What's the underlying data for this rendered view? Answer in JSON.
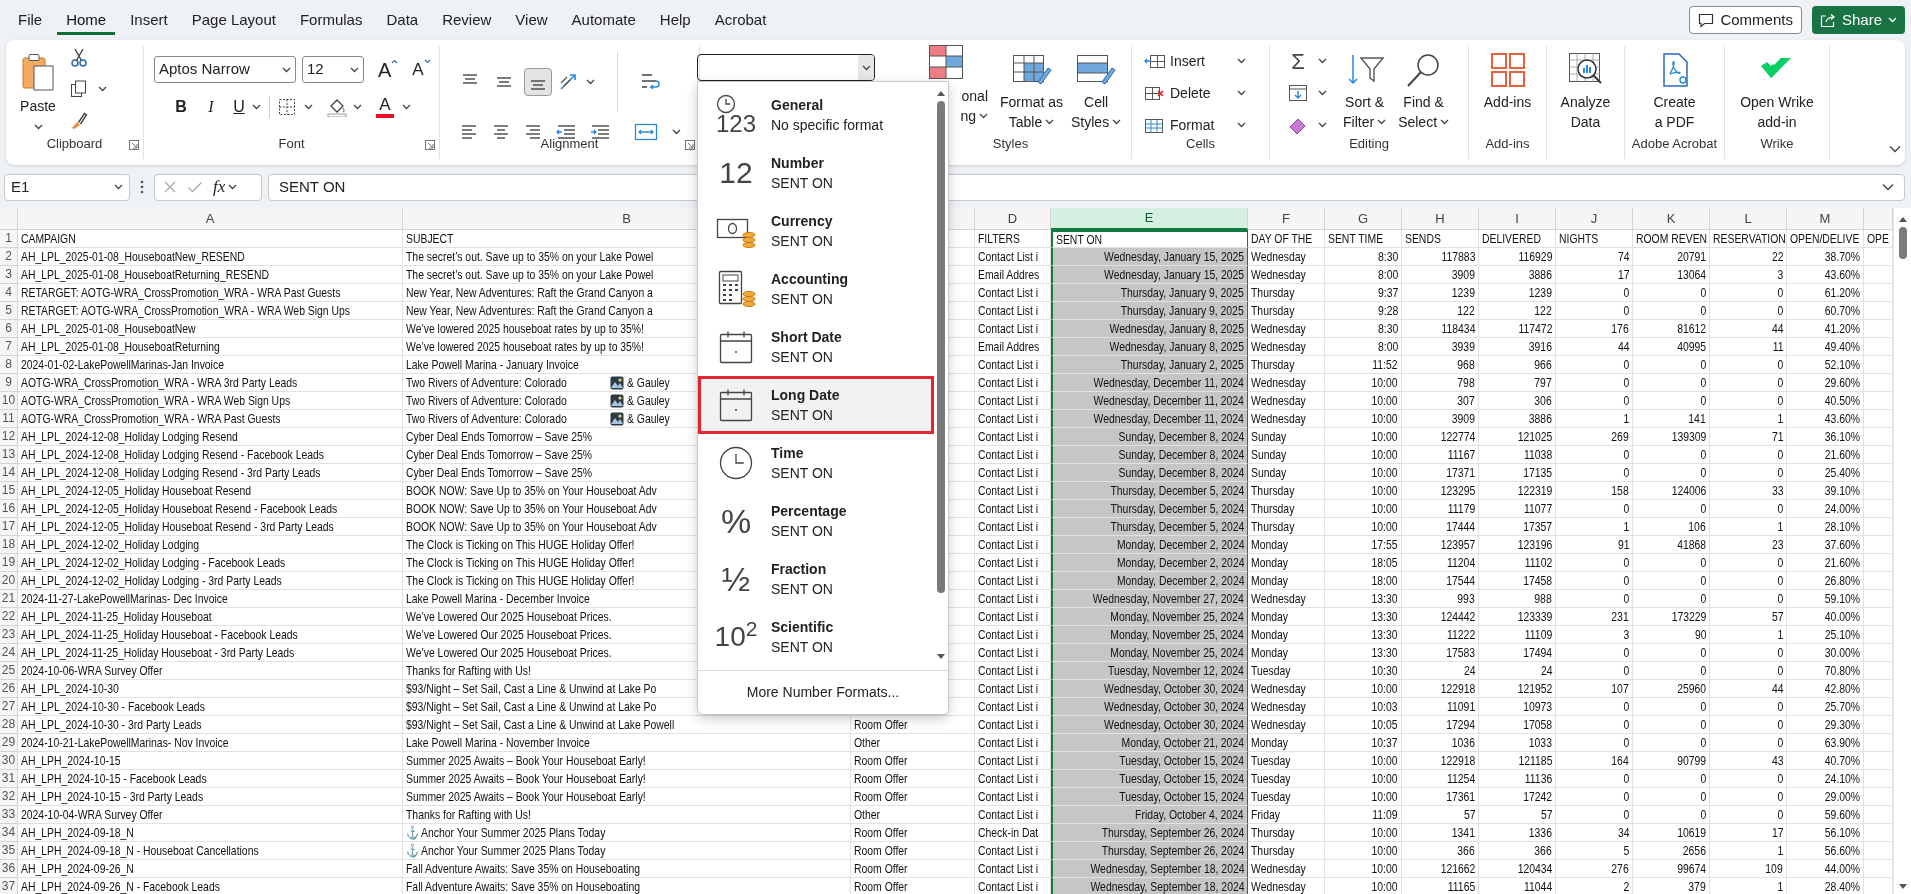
{
  "menu_tabs": [
    {
      "label": "File",
      "selected": false
    },
    {
      "label": "Home",
      "selected": true
    },
    {
      "label": "Insert",
      "selected": false
    },
    {
      "label": "Page Layout",
      "selected": false
    },
    {
      "label": "Formulas",
      "selected": false
    },
    {
      "label": "Data",
      "selected": false
    },
    {
      "label": "Review",
      "selected": false
    },
    {
      "label": "View",
      "selected": false
    },
    {
      "label": "Automate",
      "selected": false
    },
    {
      "label": "Help",
      "selected": false
    },
    {
      "label": "Acrobat",
      "selected": false
    }
  ],
  "comments_button": "Comments",
  "share_button": "Share",
  "ribbon": {
    "clipboard": {
      "paste": "Paste",
      "label": "Clipboard"
    },
    "font": {
      "family": "Aptos Narrow",
      "size": "12",
      "grow": "A",
      "shrink": "A",
      "bold": "B",
      "italic": "I",
      "underline": "U",
      "font_color": "A",
      "label": "Font"
    },
    "alignment": {
      "label": "Alignment",
      "vertical_align": [
        {
          "selected": false
        },
        {
          "selected": false
        },
        {
          "selected": true
        }
      ]
    },
    "styles": {
      "conditional": [
        "onal",
        "ng"
      ],
      "format_as_table": [
        "Format as",
        "Table"
      ],
      "cell_styles": [
        "Cell",
        "Styles"
      ],
      "label": "Styles"
    },
    "cells": {
      "buttons": [
        "Insert",
        "Delete",
        "Format"
      ],
      "label": "Cells"
    },
    "editing": {
      "autosum": "Σ",
      "sort_filter": [
        "Sort &",
        "Filter"
      ],
      "find_select": [
        "Find &",
        "Select"
      ],
      "label": "Editing"
    },
    "addins": {
      "button": "Add-ins",
      "label": "Add-ins"
    },
    "analyze": {
      "button": [
        "Analyze",
        "Data"
      ]
    },
    "acrobat": {
      "button": [
        "Create",
        "a PDF"
      ],
      "label": "Adobe Acrobat"
    },
    "wrike": {
      "button": [
        "Open Wrike",
        "add-in"
      ],
      "label": "Wrike"
    }
  },
  "formula_bar": {
    "name_box": "E1",
    "fx": "fx",
    "value": "SENT ON"
  },
  "format_menu": {
    "items": [
      {
        "kind": "general",
        "name": "General",
        "sample": "No specific format",
        "glyph": "123",
        "selected": false
      },
      {
        "kind": "number",
        "name": "Number",
        "sample": "SENT ON",
        "glyph": "12",
        "selected": false
      },
      {
        "kind": "currency",
        "name": "Currency",
        "sample": "SENT ON",
        "selected": false
      },
      {
        "kind": "accounting",
        "name": "Accounting",
        "sample": "SENT ON",
        "selected": false
      },
      {
        "kind": "short_date",
        "name": "Short Date",
        "sample": "SENT ON",
        "selected": false
      },
      {
        "kind": "long_date",
        "name": "Long Date",
        "sample": "SENT ON",
        "selected": true
      },
      {
        "kind": "time",
        "name": "Time",
        "sample": "SENT ON",
        "selected": false
      },
      {
        "kind": "percentage",
        "name": "Percentage",
        "sample": "SENT ON",
        "glyph": "%",
        "selected": false
      },
      {
        "kind": "fraction",
        "name": "Fraction",
        "sample": "SENT ON",
        "glyph": "½",
        "selected": false
      },
      {
        "kind": "scientific",
        "name": "Scientific",
        "sample": "SENT ON",
        "glyph": "10$^{2}$",
        "selected": false
      }
    ],
    "more": "More Number Formats..."
  },
  "grid": {
    "columns": [
      {
        "letter": "A",
        "selected": false
      },
      {
        "letter": "B",
        "selected": false
      },
      {
        "selected": false
      },
      {
        "letter": "D",
        "selected": false
      },
      {
        "letter": "E",
        "selected": true
      },
      {
        "letter": "F",
        "selected": false
      },
      {
        "letter": "G",
        "selected": false
      },
      {
        "letter": "H",
        "selected": false
      },
      {
        "letter": "I",
        "selected": false
      },
      {
        "letter": "J",
        "selected": false
      },
      {
        "letter": "K",
        "selected": false
      },
      {
        "letter": "L",
        "selected": false
      },
      {
        "letter": "M",
        "selected": false
      },
      {
        "selected": false
      }
    ],
    "rows": [
      {
        "row": "1",
        "active": true,
        "a": "CAMPAIGN",
        "b": "SUBJECT",
        "d": "FILTERS",
        "e": "SENT ON",
        "f": "DAY OF THE",
        "g": "SENT TIME",
        "h": "SENDS",
        "i": "DELIVERED",
        "j": "NIGHTS",
        "k": "ROOM REVEN",
        "l": "RESERVATION",
        "m": "OPEN/DELIVE",
        "n": "OPE"
      },
      {
        "row": "2",
        "active": false,
        "a": "AH_LPL_2025-01-08_HouseboatNew_RESEND",
        "b": "The secret’s out. Save up to 35% on your Lake Powel",
        "d": "Contact List i",
        "e": "Wednesday, January 15, 2025",
        "f": "Wednesday",
        "g": "8:30",
        "h": "117883",
        "i": "116929",
        "j": "74",
        "k": "20791",
        "l": "22",
        "m": "38.70%"
      },
      {
        "row": "3",
        "active": false,
        "a": "AH_LPL_2025-01-08_HouseboatReturning_RESEND",
        "b": "The secret’s out. Save up to 35% on your Lake Powel",
        "d": "Email Addres",
        "e": "Wednesday, January 15, 2025",
        "f": "Wednesday",
        "g": "8:00",
        "h": "3909",
        "i": "3886",
        "j": "17",
        "k": "13064",
        "l": "3",
        "m": "43.60%"
      },
      {
        "row": "4",
        "active": false,
        "a": "RETARGET: AOTG-WRA_CrossPromotion_WRA - WRA Past Guests",
        "b": "New Year, New Adventures: Raft the Grand Canyon a",
        "d": "Contact List i",
        "e": "Thursday, January 9, 2025",
        "f": "Thursday",
        "g": "9:37",
        "h": "1239",
        "i": "1239",
        "j": "0",
        "k": "0",
        "l": "0",
        "m": "61.20%"
      },
      {
        "row": "5",
        "active": false,
        "a": "RETARGET: AOTG-WRA_CrossPromotion_WRA - WRA Web Sign Ups",
        "b": "New Year, New Adventures: Raft the Grand Canyon a",
        "d": "Contact List i",
        "e": "Thursday, January 9, 2025",
        "f": "Thursday",
        "g": "9:28",
        "h": "122",
        "i": "122",
        "j": "0",
        "k": "0",
        "l": "0",
        "m": "60.70%"
      },
      {
        "row": "6",
        "active": false,
        "a": "AH_LPL_2025-01-08_HouseboatNew",
        "b": "We’ve lowered 2025 houseboat rates by up to 35%!",
        "d": "Contact List i",
        "e": "Wednesday, January 8, 2025",
        "f": "Wednesday",
        "g": "8:30",
        "h": "118434",
        "i": "117472",
        "j": "176",
        "k": "81612",
        "l": "44",
        "m": "41.20%"
      },
      {
        "row": "7",
        "active": false,
        "a": "AH_LPL_2025-01-08_HouseboatReturning",
        "b": "We’ve lowered 2025 houseboat rates by up to 35%!",
        "d": "Email Addres",
        "e": "Wednesday, January 8, 2025",
        "f": "Wednesday",
        "g": "8:00",
        "h": "3939",
        "i": "3916",
        "j": "44",
        "k": "40995",
        "l": "11",
        "m": "49.40%"
      },
      {
        "row": "8",
        "active": false,
        "a": "2024-01-02-LakePowellMarinas-Jan Invoice",
        "b": "Lake Powell Marina - January Invoice",
        "d": "Contact List i",
        "e": "Thursday, January 2, 2025",
        "f": "Thursday",
        "g": "11:52",
        "h": "968",
        "i": "966",
        "j": "0",
        "k": "0",
        "l": "0",
        "m": "52.10%"
      },
      {
        "row": "9",
        "active": false,
        "a": "AOTG-WRA_CrossPromotion_WRA - WRA 3rd Party Leads",
        "b": "Two Rivers of Adventure: Colorado",
        "b_after": "& Gauley",
        "d": "Contact List i",
        "e": "Wednesday, December 11, 2024",
        "f": "Wednesday",
        "g": "10:00",
        "h": "798",
        "i": "797",
        "j": "0",
        "k": "0",
        "l": "0",
        "m": "29.60%"
      },
      {
        "row": "10",
        "active": false,
        "a": "AOTG-WRA_CrossPromotion_WRA - WRA Web Sign Ups",
        "b": "Two Rivers of Adventure: Colorado",
        "b_after": "& Gauley",
        "d": "Contact List i",
        "e": "Wednesday, December 11, 2024",
        "f": "Wednesday",
        "g": "10:00",
        "h": "307",
        "i": "306",
        "j": "0",
        "k": "0",
        "l": "0",
        "m": "40.50%"
      },
      {
        "row": "11",
        "active": false,
        "a": "AOTG-WRA_CrossPromotion_WRA - WRA Past Guests",
        "b": "Two Rivers of Adventure: Colorado",
        "b_after": "& Gauley",
        "d": "Contact List i",
        "e": "Wednesday, December 11, 2024",
        "f": "Wednesday",
        "g": "10:00",
        "h": "3909",
        "i": "3886",
        "j": "1",
        "k": "141",
        "l": "1",
        "m": "43.60%"
      },
      {
        "row": "12",
        "active": false,
        "a": "AH_LPL_2024-12-08_Holiday Lodging Resend",
        "b": "Cyber Deal Ends Tomorrow – Save 25%",
        "d": "Contact List i",
        "e": "Sunday, December 8, 2024",
        "f": "Sunday",
        "g": "10:00",
        "h": "122774",
        "i": "121025",
        "j": "269",
        "k": "139309",
        "l": "71",
        "m": "36.10%"
      },
      {
        "row": "13",
        "active": false,
        "a": "AH_LPL_2024-12-08_Holiday Lodging Resend - Facebook Leads",
        "b": "Cyber Deal Ends Tomorrow – Save 25%",
        "d": "Contact List i",
        "e": "Sunday, December 8, 2024",
        "f": "Sunday",
        "g": "10:00",
        "h": "11167",
        "i": "11038",
        "j": "0",
        "k": "0",
        "l": "0",
        "m": "21.60%"
      },
      {
        "row": "14",
        "active": false,
        "a": "AH_LPL_2024-12-08_Holiday Lodging Resend - 3rd Party Leads",
        "b": "Cyber Deal Ends Tomorrow – Save 25%",
        "d": "Contact List i",
        "e": "Sunday, December 8, 2024",
        "f": "Sunday",
        "g": "10:00",
        "h": "17371",
        "i": "17135",
        "j": "0",
        "k": "0",
        "l": "0",
        "m": "25.40%"
      },
      {
        "row": "15",
        "active": false,
        "a": "AH_LPL_2024-12-05_Holiday Houseboat Resend",
        "b": "BOOK NOW: Save Up to 35% on Your Houseboat Adv",
        "d": "Contact List i",
        "e": "Thursday, December 5, 2024",
        "f": "Thursday",
        "g": "10:00",
        "h": "123295",
        "i": "122319",
        "j": "158",
        "k": "124006",
        "l": "33",
        "m": "39.10%"
      },
      {
        "row": "16",
        "active": false,
        "a": "AH_LPL_2024-12-05_Holiday Houseboat Resend - Facebook Leads",
        "b": "BOOK NOW: Save Up to 35% on Your Houseboat Adv",
        "d": "Contact List i",
        "e": "Thursday, December 5, 2024",
        "f": "Thursday",
        "g": "10:00",
        "h": "11179",
        "i": "11077",
        "j": "0",
        "k": "0",
        "l": "0",
        "m": "24.00%"
      },
      {
        "row": "17",
        "active": false,
        "a": "AH_LPL_2024-12-05_Holiday Houseboat Resend - 3rd Party Leads",
        "b": "BOOK NOW: Save Up to 35% on Your Houseboat Adv",
        "d": "Contact List i",
        "e": "Thursday, December 5, 2024",
        "f": "Thursday",
        "g": "10:00",
        "h": "17444",
        "i": "17357",
        "j": "1",
        "k": "106",
        "l": "1",
        "m": "28.10%"
      },
      {
        "row": "18",
        "active": false,
        "a": "AH_LPL_2024-12-02_Holiday Lodging",
        "b": "The Clock is Ticking on This HUGE Holiday Offer!",
        "d": "Contact List i",
        "e": "Monday, December 2, 2024",
        "f": "Monday",
        "g": "17:55",
        "h": "123957",
        "i": "123196",
        "j": "91",
        "k": "41868",
        "l": "23",
        "m": "37.60%"
      },
      {
        "row": "19",
        "active": false,
        "a": "AH_LPL_2024-12-02_Holiday Lodging - Facebook Leads",
        "b": "The Clock is Ticking on This HUGE Holiday Offer!",
        "d": "Contact List i",
        "e": "Monday, December 2, 2024",
        "f": "Monday",
        "g": "18:05",
        "h": "11204",
        "i": "11102",
        "j": "0",
        "k": "0",
        "l": "0",
        "m": "21.60%"
      },
      {
        "row": "20",
        "active": false,
        "a": "AH_LPL_2024-12-02_Holiday Lodging - 3rd Party Leads",
        "b": "The Clock is Ticking on This HUGE Holiday Offer!",
        "d": "Contact List i",
        "e": "Monday, December 2, 2024",
        "f": "Monday",
        "g": "18:00",
        "h": "17544",
        "i": "17458",
        "j": "0",
        "k": "0",
        "l": "0",
        "m": "26.80%"
      },
      {
        "row": "21",
        "active": false,
        "a": "2024-11-27-LakePowellMarinas- Dec Invoice",
        "b": "Lake Powell Marina - December Invoice",
        "d": "Contact List i",
        "e": "Wednesday, November 27, 2024",
        "f": "Wednesday",
        "g": "13:30",
        "h": "993",
        "i": "988",
        "j": "0",
        "k": "0",
        "l": "0",
        "m": "59.10%"
      },
      {
        "row": "22",
        "active": false,
        "a": "AH_LPL_2024-11-25_Holiday Houseboat",
        "b": "We’ve Lowered Our 2025 Houseboat Prices.",
        "d": "Contact List i",
        "e": "Monday, November 25, 2024",
        "f": "Monday",
        "g": "13:30",
        "h": "124442",
        "i": "123339",
        "j": "231",
        "k": "173229",
        "l": "57",
        "m": "40.00%"
      },
      {
        "row": "23",
        "active": false,
        "a": "AH_LPL_2024-11-25_Holiday Houseboat - Facebook Leads",
        "b": "We’ve Lowered Our 2025 Houseboat Prices.",
        "d": "Contact List i",
        "e": "Monday, November 25, 2024",
        "f": "Monday",
        "g": "13:30",
        "h": "11222",
        "i": "11109",
        "j": "3",
        "k": "90",
        "l": "1",
        "m": "25.10%"
      },
      {
        "row": "24",
        "active": false,
        "a": "AH_LPL_2024-11-25_Holiday Houseboat - 3rd Party Leads",
        "b": "We’ve Lowered Our 2025 Houseboat Prices.",
        "d": "Contact List i",
        "e": "Monday, November 25, 2024",
        "f": "Monday",
        "g": "13:30",
        "h": "17583",
        "i": "17494",
        "j": "0",
        "k": "0",
        "l": "0",
        "m": "30.00%"
      },
      {
        "row": "25",
        "active": false,
        "a": "2024-10-06-WRA Survey Offer",
        "b": "Thanks for Rafting with Us!",
        "d": "Contact List i",
        "e": "Tuesday, November 12, 2024",
        "f": "Tuesday",
        "g": "10:30",
        "h": "24",
        "i": "24",
        "j": "0",
        "k": "0",
        "l": "0",
        "m": "70.80%"
      },
      {
        "row": "26",
        "active": false,
        "a": "AH_LPL_2024-10-30",
        "b": "$93/Night – Set Sail, Cast a Line & Unwind at Lake Po",
        "d": "Contact List i",
        "e": "Wednesday, October 30, 2024",
        "f": "Wednesday",
        "g": "10:00",
        "h": "122918",
        "i": "121952",
        "j": "107",
        "k": "25960",
        "l": "44",
        "m": "42.80%"
      },
      {
        "row": "27",
        "active": false,
        "a": "AH_LPL_2024-10-30 - Facebook Leads",
        "b": "$93/Night – Set Sail, Cast a Line & Unwind at Lake Po",
        "d": "Contact List i",
        "e": "Wednesday, October 30, 2024",
        "f": "Wednesday",
        "g": "10:03",
        "h": "11091",
        "i": "10973",
        "j": "0",
        "k": "0",
        "l": "0",
        "m": "25.70%"
      },
      {
        "row": "28",
        "active": false,
        "a": "AH_LPL_2024-10-30 - 3rd Party Leads",
        "b": "$93/Night – Set Sail, Cast a Line & Unwind at Lake Powell",
        "c": "Room Offer",
        "d": "Contact List i",
        "e": "Wednesday, October 30, 2024",
        "f": "Wednesday",
        "g": "10:05",
        "h": "17294",
        "i": "17058",
        "j": "0",
        "k": "0",
        "l": "0",
        "m": "29.30%"
      },
      {
        "row": "29",
        "active": false,
        "a": "2024-10-21-LakePowellMarinas- Nov Invoice",
        "b": "Lake Powell Marina - November Invoice",
        "c": "Other",
        "d": "Contact List i",
        "e": "Monday, October 21, 2024",
        "f": "Monday",
        "g": "10:37",
        "h": "1036",
        "i": "1033",
        "j": "0",
        "k": "0",
        "l": "0",
        "m": "63.90%"
      },
      {
        "row": "30",
        "active": false,
        "a": "AH_LPH_2024-10-15",
        "b": "Summer 2025 Awaits – Book Your Houseboat Early!",
        "c": "Room Offer",
        "d": "Contact List i",
        "e": "Tuesday, October 15, 2024",
        "f": "Tuesday",
        "g": "10:00",
        "h": "122918",
        "i": "121185",
        "j": "164",
        "k": "90799",
        "l": "43",
        "m": "40.70%"
      },
      {
        "row": "31",
        "active": false,
        "a": "AH_LPH_2024-10-15 - Facebook Leads",
        "b": "Summer 2025 Awaits – Book Your Houseboat Early!",
        "c": "Room Offer",
        "d": "Contact List i",
        "e": "Tuesday, October 15, 2024",
        "f": "Tuesday",
        "g": "10:00",
        "h": "11254",
        "i": "11136",
        "j": "0",
        "k": "0",
        "l": "0",
        "m": "24.10%"
      },
      {
        "row": "32",
        "active": false,
        "a": "AH_LPH_2024-10-15 - 3rd Party Leads",
        "b": "Summer 2025 Awaits – Book Your Houseboat Early!",
        "c": "Room Offer",
        "d": "Contact List i",
        "e": "Tuesday, October 15, 2024",
        "f": "Tuesday",
        "g": "10:00",
        "h": "17361",
        "i": "17242",
        "j": "0",
        "k": "0",
        "l": "0",
        "m": "29.00%"
      },
      {
        "row": "33",
        "active": false,
        "a": "2024-10-04-WRA Survey Offer",
        "b": "Thanks for Rafting with Us!",
        "c": "Other",
        "d": "Contact List i",
        "e": "Friday, October 4, 2024",
        "f": "Friday",
        "g": "11:09",
        "h": "57",
        "i": "57",
        "j": "0",
        "k": "0",
        "l": "0",
        "m": "59.60%"
      },
      {
        "row": "34",
        "active": false,
        "a": "AH_LPH_2024-09-18_N",
        "b": "⚓ Anchor Your Summer 2025 Plans Today",
        "c": "Room Offer",
        "d": "Check-in Dat",
        "e": "Thursday, September 26, 2024",
        "f": "Thursday",
        "g": "10:00",
        "h": "1341",
        "i": "1336",
        "j": "34",
        "k": "10619",
        "l": "17",
        "m": "56.10%"
      },
      {
        "row": "35",
        "active": false,
        "a": "AH_LPH_2024-09-18_N - Houseboat Cancellations",
        "b": "⚓ Anchor Your Summer 2025 Plans Today",
        "c": "Room Offer",
        "d": "Contact List i",
        "e": "Thursday, September 26, 2024",
        "f": "Thursday",
        "g": "10:00",
        "h": "366",
        "i": "366",
        "j": "5",
        "k": "2656",
        "l": "1",
        "m": "56.60%"
      },
      {
        "row": "36",
        "active": false,
        "a": "AH_LPH_2024-09-26_N",
        "b": "Fall Adventure Awaits: Save 35% on Houseboating",
        "c": "Room Offer",
        "d": "Contact List i",
        "e": "Wednesday, September 18, 2024",
        "f": "Wednesday",
        "g": "10:00",
        "h": "121662",
        "i": "120434",
        "j": "276",
        "k": "99674",
        "l": "109",
        "m": "44.00%"
      },
      {
        "row": "37",
        "active": false,
        "a": "AH_LPH_2024-09-26_N - Facebook Leads",
        "b": "Fall Adventure Awaits: Save 35% on Houseboating",
        "c": "Room Offer",
        "d": "Contact List i",
        "e": "Wednesday, September 18, 2024",
        "f": "Wednesday",
        "g": "10:00",
        "h": "11165",
        "i": "11044",
        "j": "2",
        "k": "379",
        "l": "1",
        "m": "28.40%"
      }
    ]
  }
}
